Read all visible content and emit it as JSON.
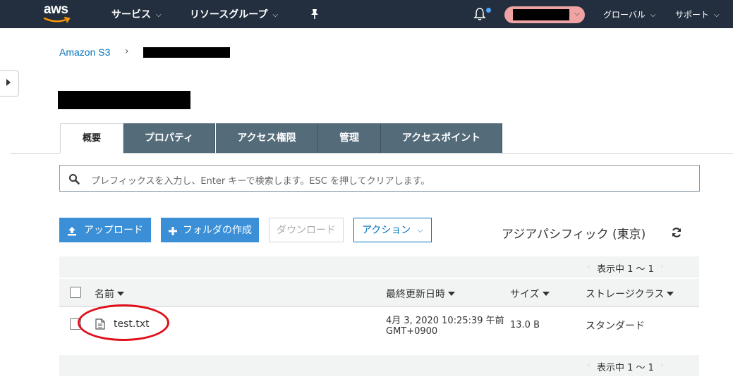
{
  "topnav": {
    "logo_text": "aws",
    "services": "サービス",
    "resource_groups": "リソースグループ",
    "global": "グローバル",
    "support": "サポート",
    "caret": "⌄"
  },
  "breadcrumb": {
    "root": "Amazon S3",
    "separator": "›"
  },
  "tabs": [
    "概要",
    "プロパティ",
    "アクセス権限",
    "管理",
    "アクセスポイント"
  ],
  "search": {
    "placeholder": "プレフィックスを入力し、Enter キーで検索します。ESC を押してクリアします。"
  },
  "toolbar": {
    "upload": "アップロード",
    "create_folder": "フォルダの作成",
    "download": "ダウンロード",
    "actions": "アクション"
  },
  "region": "アジアパシフィック (東京)",
  "pager": {
    "text": "表示中 1 ～ 1",
    "prev": "‹",
    "next": "›"
  },
  "table": {
    "headers": {
      "name": "名前",
      "last_modified": "最終更新日時",
      "size": "サイズ",
      "storage_class": "ストレージクラス"
    },
    "rows": [
      {
        "name": "test.txt",
        "last_modified_line1": "4月 3, 2020 10:25:39 午前",
        "last_modified_line2": "GMT+0900",
        "size": "13.0 B",
        "storage_class": "スタンダード"
      }
    ]
  },
  "colors": {
    "nav_bg": "#232f3e",
    "tab_bg": "#546b7a",
    "primary": "#3a8fd6",
    "link": "#0073bb",
    "highlight_circle": "#e0101b",
    "account_pill": "#f0a3a3",
    "notification_dot": "#4da6ff"
  },
  "icons": [
    "aws-logo",
    "pin-icon",
    "bell-icon",
    "search-icon",
    "upload-icon",
    "plus-icon",
    "refresh-icon",
    "file-icon",
    "sort-triangle-icon"
  ]
}
